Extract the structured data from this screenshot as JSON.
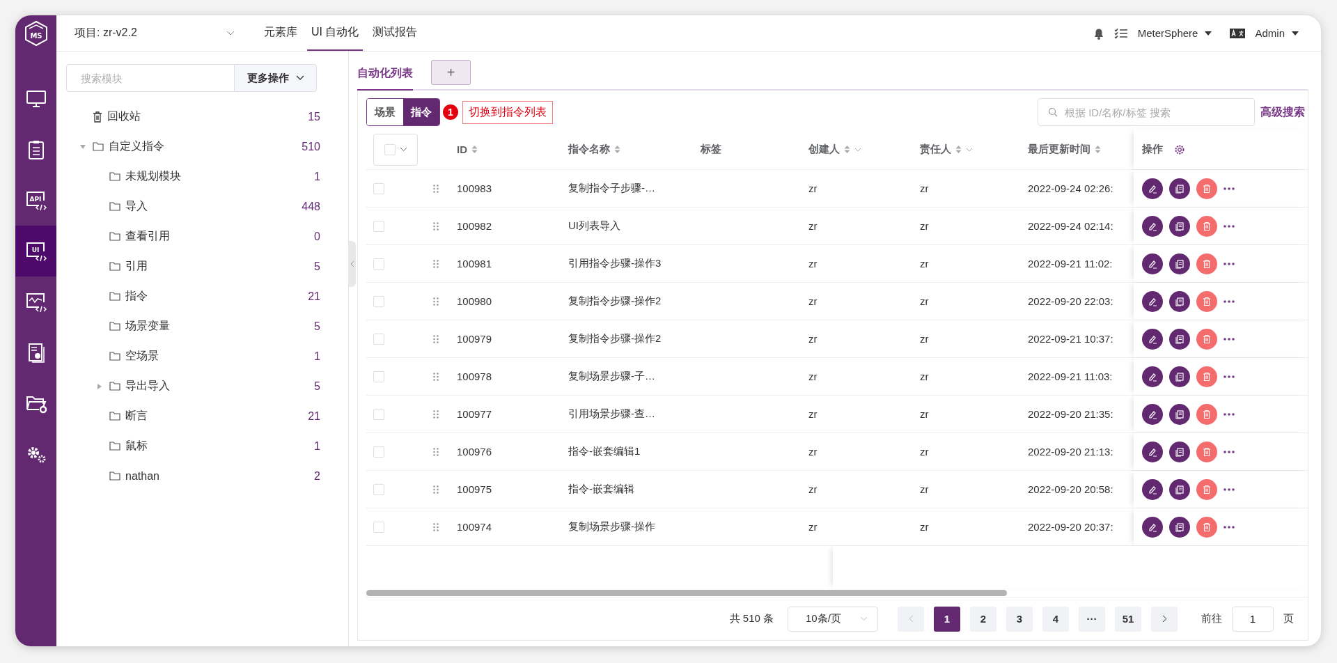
{
  "logo": {
    "text": "MS"
  },
  "nav": [
    {
      "kind": "monitor",
      "selected": false
    },
    {
      "kind": "clipboard",
      "selected": false
    },
    {
      "kind": "code",
      "icon_text": "API",
      "selected": false
    },
    {
      "kind": "code",
      "icon_text": "UI",
      "selected": true
    },
    {
      "kind": "chart",
      "selected": false
    },
    {
      "kind": "report",
      "selected": false
    },
    {
      "kind": "folder",
      "selected": false
    },
    {
      "kind": "settings",
      "selected": false
    }
  ],
  "header": {
    "project": "项目: zr-v2.2",
    "tabs": [
      {
        "label": "元素库",
        "selected": false
      },
      {
        "label": "UI 自动化",
        "selected": true
      },
      {
        "label": "测试报告",
        "selected": false
      }
    ],
    "workspace": "MeterSphere",
    "user": "Admin"
  },
  "module_panel": {
    "search": {
      "placeholder": "搜索模块"
    },
    "more_button": "更多操作",
    "tree": [
      {
        "kind": "trash",
        "label": "回收站",
        "count": "15"
      },
      {
        "kind": "folder",
        "label": "自定义指令",
        "count": "510",
        "expanded": true,
        "children": [
          {
            "kind": "folder",
            "label": "未规划模块",
            "count": "1"
          },
          {
            "kind": "folder",
            "label": "导入",
            "count": "448"
          },
          {
            "kind": "folder",
            "label": "查看引用",
            "count": "0"
          },
          {
            "kind": "folder",
            "label": "引用",
            "count": "5"
          },
          {
            "kind": "folder",
            "label": "指令",
            "count": "21"
          },
          {
            "kind": "folder",
            "label": "场景变量",
            "count": "5"
          },
          {
            "kind": "folder",
            "label": "空场景",
            "count": "1"
          },
          {
            "kind": "folder",
            "label": "导出导入",
            "count": "5",
            "expanded": false
          },
          {
            "kind": "folder",
            "label": "断言",
            "count": "21"
          },
          {
            "kind": "folder",
            "label": "鼠标",
            "count": "1"
          },
          {
            "kind": "folder",
            "label": "nathan",
            "count": "2"
          }
        ]
      }
    ]
  },
  "list_tabs": [
    {
      "label": "自动化列表",
      "selected": true
    }
  ],
  "add_tab_button": "+",
  "mode_toggle": [
    {
      "label": "场景",
      "selected": false
    },
    {
      "label": "指令",
      "selected": true
    }
  ],
  "callout": {
    "number": "1",
    "text": "切换到指令列表"
  },
  "table_search": {
    "placeholder": "根据 ID/名称/标签 搜索"
  },
  "advanced_search": "高级搜索",
  "table": {
    "select_all": {
      "checked": false
    },
    "columns": [
      {
        "label": "ID",
        "sortable": true,
        "filterable": false
      },
      {
        "label": "指令名称",
        "sortable": true,
        "filterable": false
      },
      {
        "label": "标签",
        "sortable": false,
        "filterable": false
      },
      {
        "label": "创建人",
        "sortable": true,
        "filterable": true
      },
      {
        "label": "责任人",
        "sortable": true,
        "filterable": true
      },
      {
        "label": "最后更新时间",
        "sortable": true,
        "filterable": false
      }
    ],
    "actions_column": "操作",
    "rows": [
      {
        "checked": false,
        "id": "100983",
        "name": "复制指令子步骤-…",
        "creator": "zr",
        "owner": "zr",
        "updated": "2022-09-24 02:26:"
      },
      {
        "checked": false,
        "id": "100982",
        "name": "UI列表导入",
        "creator": "zr",
        "owner": "zr",
        "updated": "2022-09-24 02:14:"
      },
      {
        "checked": false,
        "id": "100981",
        "name": "引用指令步骤-操作3",
        "creator": "zr",
        "owner": "zr",
        "updated": "2022-09-21 11:02:"
      },
      {
        "checked": false,
        "id": "100980",
        "name": "复制指令步骤-操作2",
        "creator": "zr",
        "owner": "zr",
        "updated": "2022-09-20 22:03:"
      },
      {
        "checked": false,
        "id": "100979",
        "name": "复制指令步骤-操作2",
        "creator": "zr",
        "owner": "zr",
        "updated": "2022-09-21 10:37:"
      },
      {
        "checked": false,
        "id": "100978",
        "name": "复制场景步骤-子…",
        "creator": "zr",
        "owner": "zr",
        "updated": "2022-09-21 11:03:"
      },
      {
        "checked": false,
        "id": "100977",
        "name": "引用场景步骤-查…",
        "creator": "zr",
        "owner": "zr",
        "updated": "2022-09-20 21:35:"
      },
      {
        "checked": false,
        "id": "100976",
        "name": "指令-嵌套编辑1",
        "creator": "zr",
        "owner": "zr",
        "updated": "2022-09-20 21:13:"
      },
      {
        "checked": false,
        "id": "100975",
        "name": "指令-嵌套编辑",
        "creator": "zr",
        "owner": "zr",
        "updated": "2022-09-20 20:58:"
      },
      {
        "checked": false,
        "id": "100974",
        "name": "复制场景步骤-操作",
        "creator": "zr",
        "owner": "zr",
        "updated": "2022-09-20 20:37:"
      }
    ]
  },
  "pagination": {
    "total": "共 510 条",
    "page_size": "10条/页",
    "pages": [
      {
        "label": "1",
        "selected": true
      },
      {
        "label": "2",
        "selected": false
      },
      {
        "label": "3",
        "selected": false
      },
      {
        "label": "4",
        "selected": false
      },
      {
        "label": "···",
        "selected": false
      },
      {
        "label": "51",
        "selected": false
      }
    ],
    "goto_label": "前往",
    "goto_value": "1",
    "page_unit": "页"
  }
}
